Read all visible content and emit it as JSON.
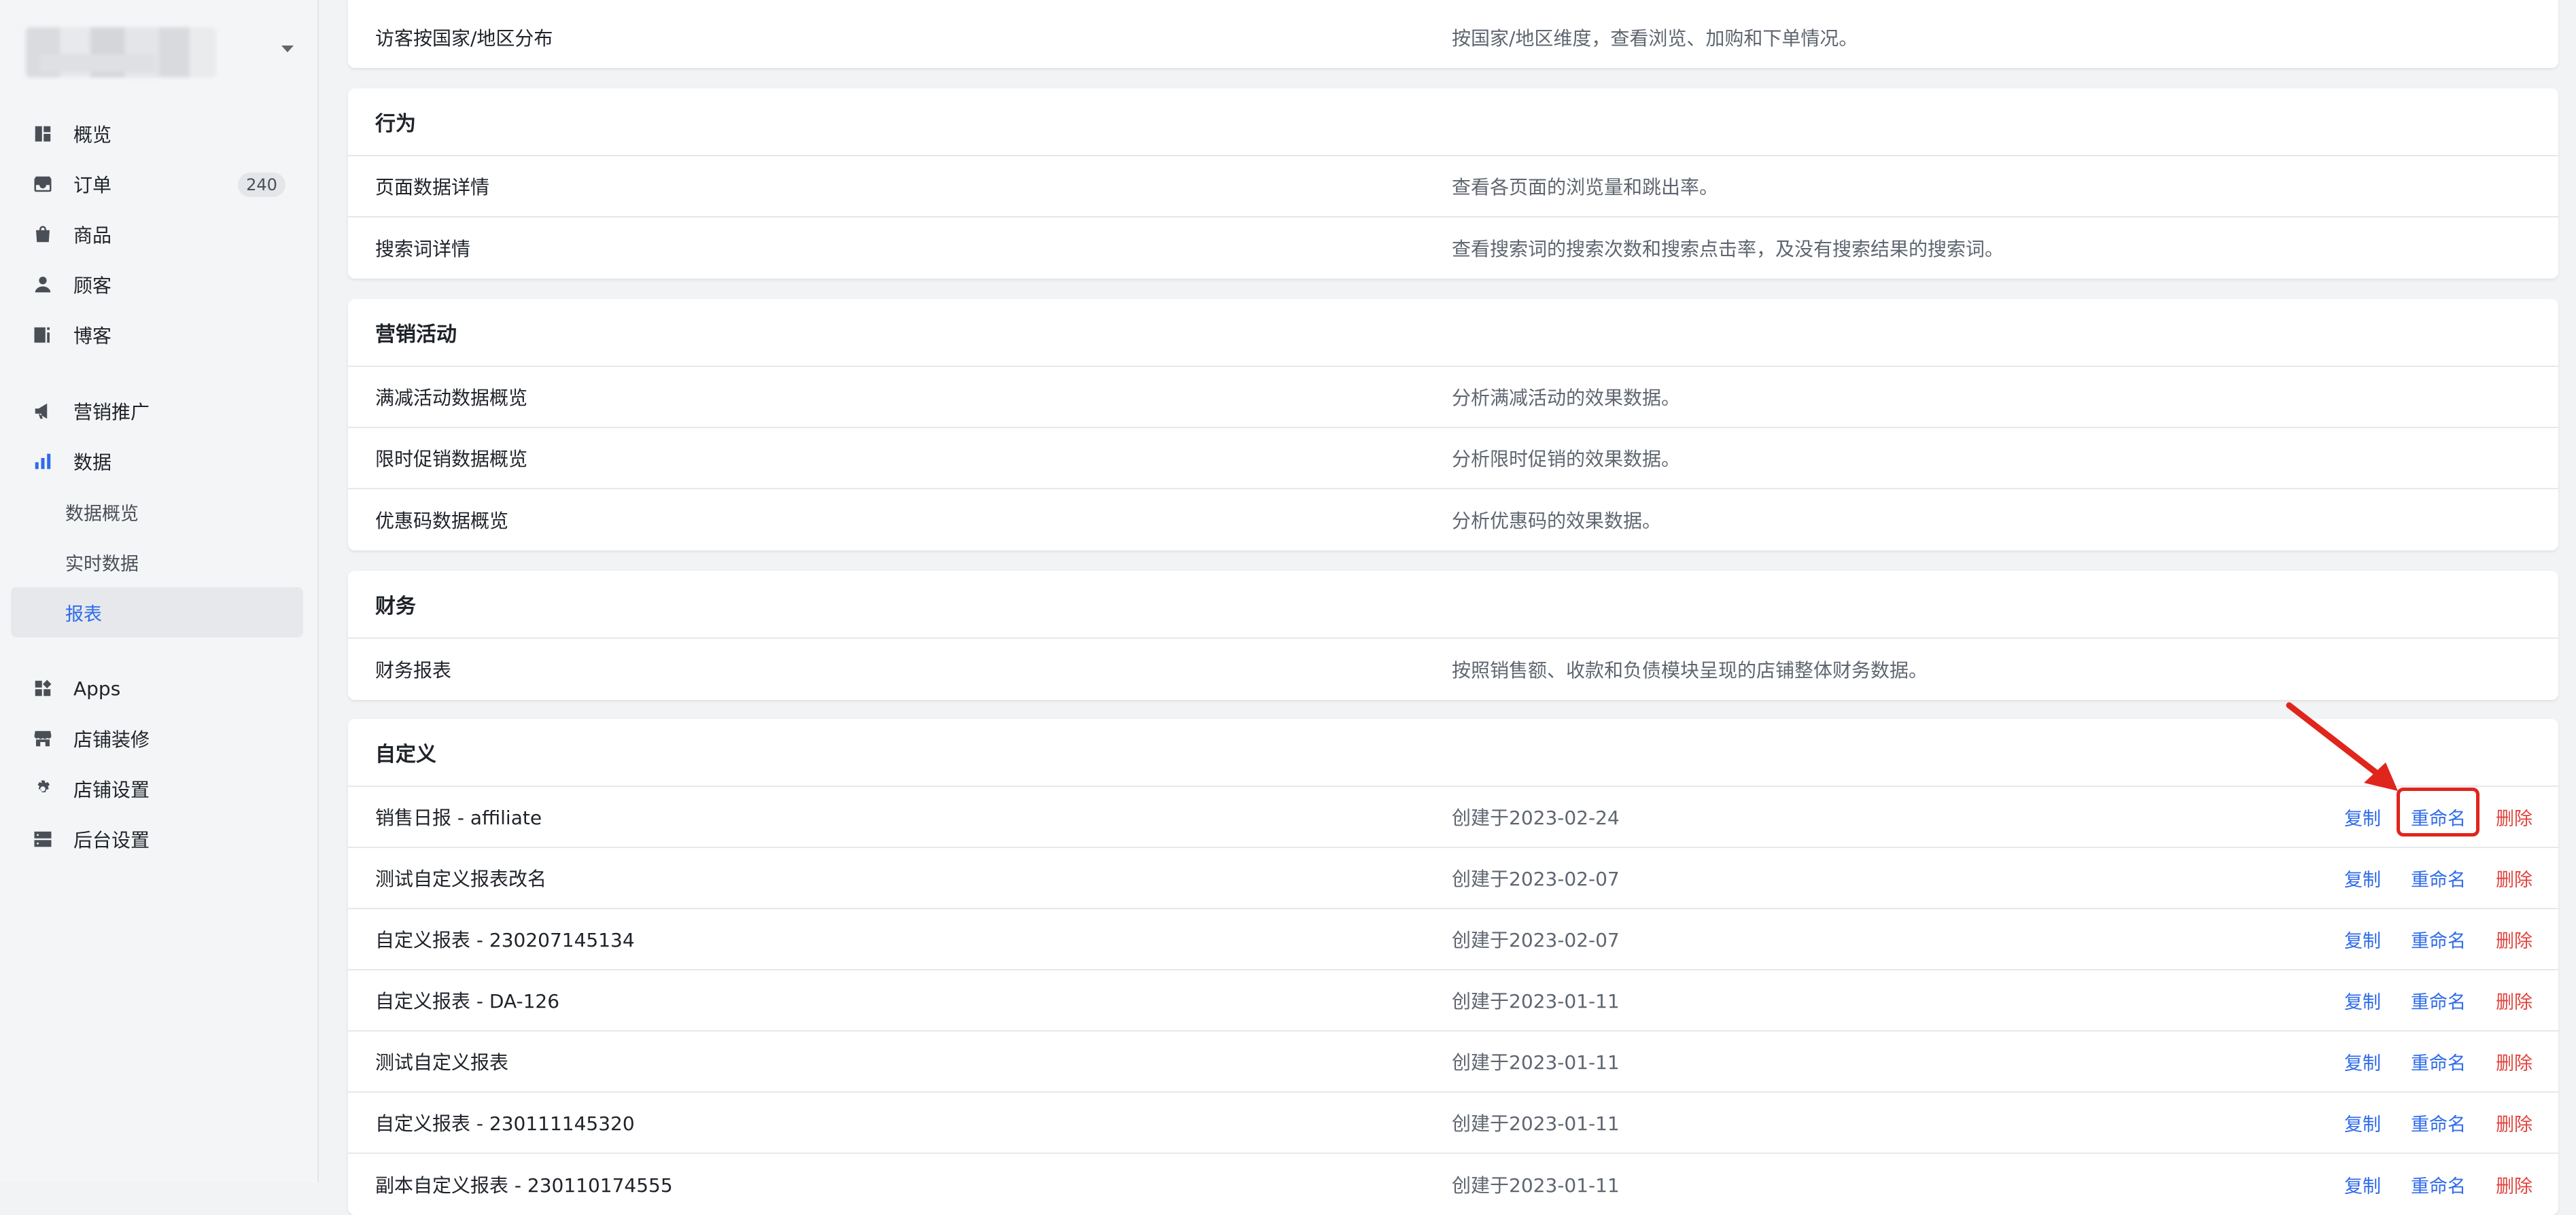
{
  "sidebar": {
    "nav": [
      {
        "label": "概览",
        "icon": "dashboard-icon"
      },
      {
        "label": "订单",
        "icon": "inbox-icon",
        "badge": "240"
      },
      {
        "label": "商品",
        "icon": "bag-icon"
      },
      {
        "label": "顾客",
        "icon": "person-icon"
      },
      {
        "label": "博客",
        "icon": "blog-icon"
      },
      {
        "label": "营销推广",
        "icon": "megaphone-icon"
      },
      {
        "label": "数据",
        "icon": "bar-chart-icon"
      },
      {
        "label": "数据概览"
      },
      {
        "label": "实时数据"
      },
      {
        "label": "报表",
        "active": true
      },
      {
        "label": "Apps",
        "icon": "apps-icon"
      },
      {
        "label": "店铺装修",
        "icon": "storefront-icon"
      },
      {
        "label": "店铺设置",
        "icon": "gear-icon"
      },
      {
        "label": "后台设置",
        "icon": "server-icon"
      }
    ]
  },
  "sections": {
    "top": {
      "rows": [
        {
          "name": "访客按国家/地区分布",
          "desc": "按国家/地区维度，查看浏览、加购和下单情况。"
        }
      ]
    },
    "behavior": {
      "title": "行为",
      "rows": [
        {
          "name": "页面数据详情",
          "desc": "查看各页面的浏览量和跳出率。"
        },
        {
          "name": "搜索词详情",
          "desc": "查看搜索词的搜索次数和搜索点击率，及没有搜索结果的搜索词。"
        }
      ]
    },
    "marketing": {
      "title": "营销活动",
      "rows": [
        {
          "name": "满减活动数据概览",
          "desc": "分析满减活动的效果数据。"
        },
        {
          "name": "限时促销数据概览",
          "desc": "分析限时促销的效果数据。"
        },
        {
          "name": "优惠码数据概览",
          "desc": "分析优惠码的效果数据。"
        }
      ]
    },
    "finance": {
      "title": "财务",
      "rows": [
        {
          "name": "财务报表",
          "desc": "按照销售额、收款和负债模块呈现的店铺整体财务数据。"
        }
      ]
    },
    "custom": {
      "title": "自定义",
      "actions": {
        "copy": "复制",
        "rename": "重命名",
        "delete": "删除"
      },
      "rows": [
        {
          "name": "销售日报 - affiliate",
          "desc": "创建于2023-02-24"
        },
        {
          "name": "测试自定义报表改名",
          "desc": "创建于2023-02-07"
        },
        {
          "name": "自定义报表 - 230207145134",
          "desc": "创建于2023-02-07"
        },
        {
          "name": "自定义报表 - DA-126",
          "desc": "创建于2023-01-11"
        },
        {
          "name": "测试自定义报表",
          "desc": "创建于2023-01-11"
        },
        {
          "name": "自定义报表 - 230111145320",
          "desc": "创建于2023-01-11"
        },
        {
          "name": "副本自定义报表 - 230110174555",
          "desc": "创建于2023-01-11"
        }
      ]
    }
  },
  "colors": {
    "accent": "#2f6bea",
    "danger": "#e0443e",
    "annotation": "#e0251d"
  }
}
